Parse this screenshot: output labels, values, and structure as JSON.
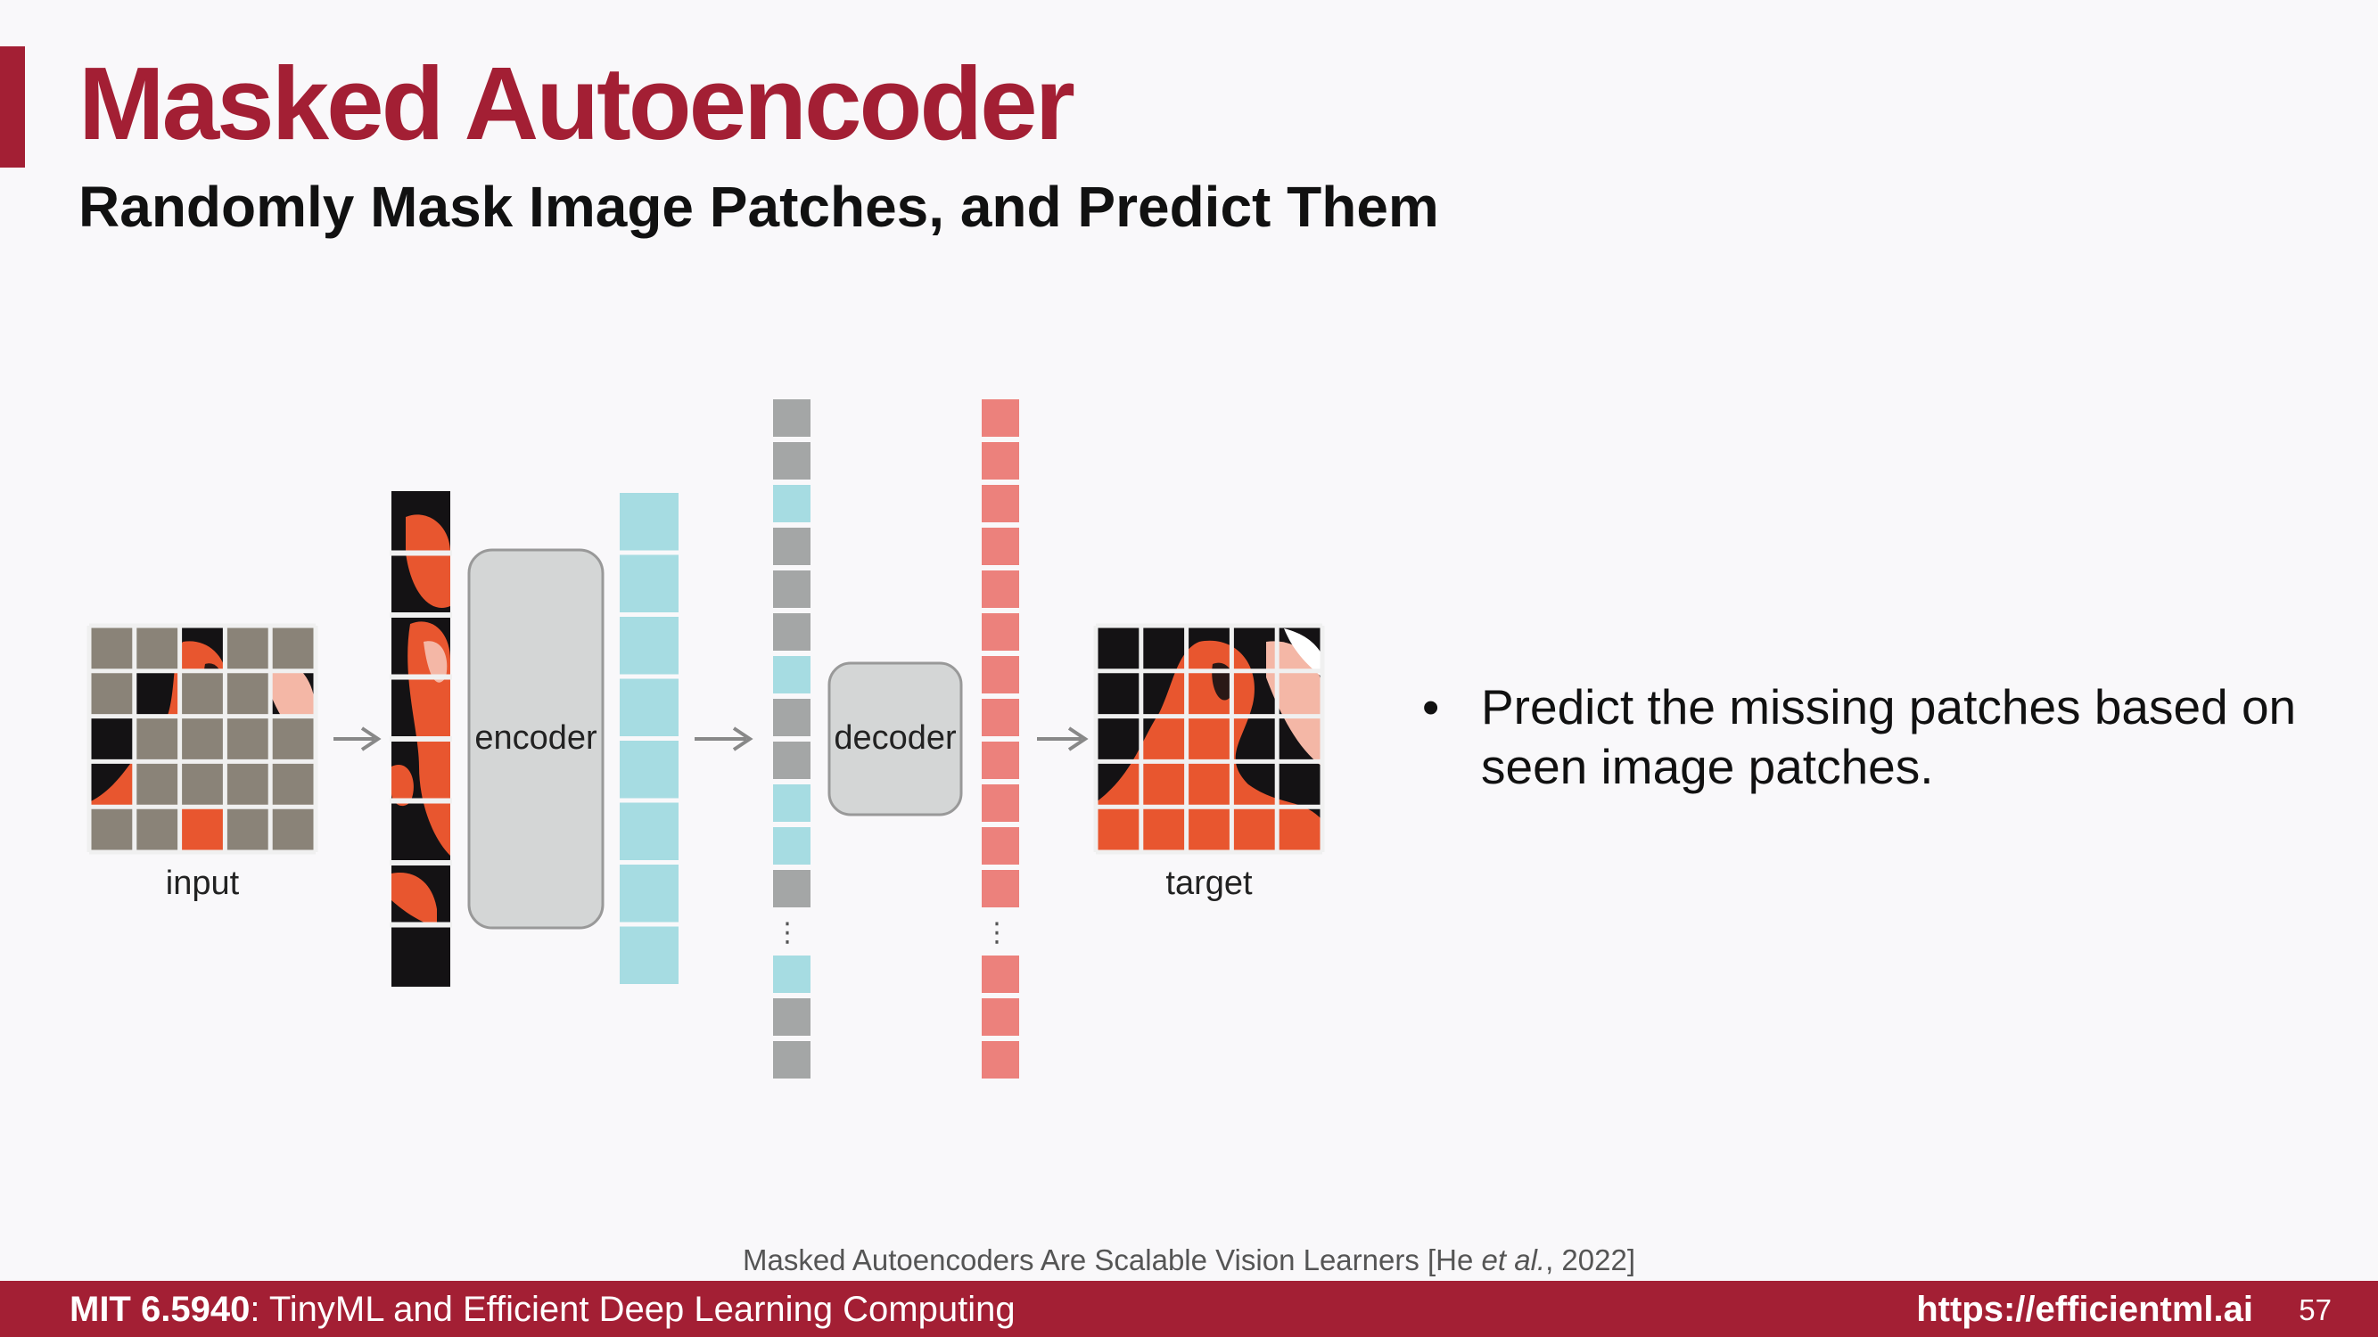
{
  "slide": {
    "title": "Masked Autoencoder",
    "subtitle": "Randomly Mask Image Patches, and Predict Them"
  },
  "diagram": {
    "labels": {
      "input": "input",
      "encoder": "encoder",
      "decoder": "decoder",
      "target": "target",
      "ellipsis": "⋮"
    },
    "colors": {
      "brand": "#a31f34",
      "masked_patch": "#8a8378",
      "grid_line": "#f0f0f0",
      "embedding_visible": "#a6dce2",
      "mask_token": "#a4a6a6",
      "output_token": "#ec817c",
      "block_fill": "#d4d6d6",
      "block_stroke": "#999999",
      "arrow": "#888888",
      "flamingo": "#e8562f",
      "background_dark": "#141214"
    },
    "input_grid_masked": [
      [
        1,
        1,
        0,
        1,
        1
      ],
      [
        1,
        0,
        1,
        1,
        0
      ],
      [
        0,
        1,
        1,
        1,
        1
      ],
      [
        0,
        1,
        1,
        1,
        1
      ],
      [
        1,
        1,
        0,
        1,
        1
      ]
    ],
    "decoder_input_tokens": [
      "mask",
      "mask",
      "visible",
      "mask",
      "mask",
      "mask",
      "visible",
      "mask",
      "mask",
      "visible",
      "visible",
      "mask",
      "ellipsis",
      "visible",
      "mask",
      "mask"
    ],
    "encoder_token_count": 8,
    "visible_patch_count": 8
  },
  "bullets": [
    "Predict the missing patches based on seen image patches."
  ],
  "citation": {
    "before": "Masked Autoencoders Are Scalable Vision Learners [He ",
    "italic": "et al.",
    "after": ", 2022]"
  },
  "footer": {
    "course": "MIT 6.5940",
    "course_title": ": TinyML and Efficient Deep Learning Computing",
    "url": "https://efficientml.ai",
    "page_number": "57"
  }
}
